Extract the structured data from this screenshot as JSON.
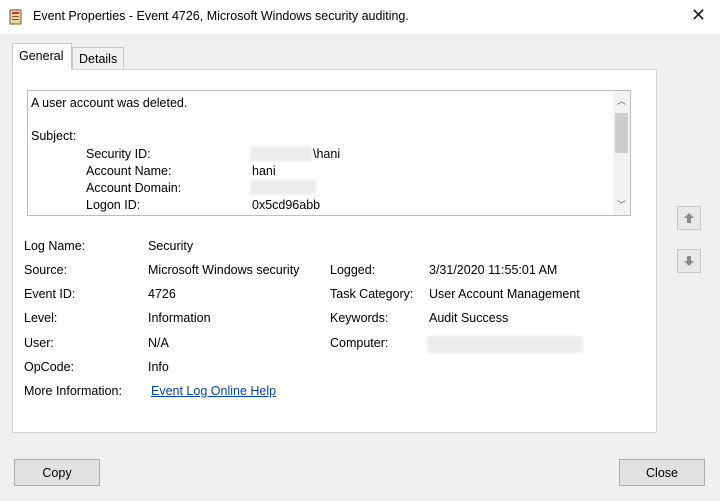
{
  "window": {
    "title": "Event Properties - Event 4726, Microsoft Windows security auditing.",
    "icon": "event-viewer-icon"
  },
  "tabs": [
    {
      "label": "General",
      "active": true
    },
    {
      "label": "Details",
      "active": false
    }
  ],
  "description": {
    "line1": "A user account was deleted.",
    "subject_label": "Subject:",
    "rows": [
      {
        "label": "Security ID:",
        "value": "\\hani"
      },
      {
        "label": "Account Name:",
        "value": "hani"
      },
      {
        "label": "Account Domain:",
        "value": ""
      },
      {
        "label": "Logon ID:",
        "value": "0x5cd96abb"
      }
    ]
  },
  "fields": {
    "log_name": {
      "label": "Log Name:",
      "value": "Security"
    },
    "source": {
      "label": "Source:",
      "value": "Microsoft Windows security"
    },
    "logged": {
      "label": "Logged:",
      "value": "3/31/2020 11:55:01 AM"
    },
    "event_id": {
      "label": "Event ID:",
      "value": "4726"
    },
    "task_category": {
      "label": "Task Category:",
      "value": "User Account Management"
    },
    "level": {
      "label": "Level:",
      "value": "Information"
    },
    "keywords": {
      "label": "Keywords:",
      "value": "Audit Success"
    },
    "user": {
      "label": "User:",
      "value": "N/A"
    },
    "computer": {
      "label": "Computer:",
      "value": ""
    },
    "opcode": {
      "label": "OpCode:",
      "value": "Info"
    },
    "more_info": {
      "label": "More Information:",
      "link": "Event Log Online Help"
    }
  },
  "buttons": {
    "copy": "Copy",
    "close": "Close"
  },
  "colors": {
    "link": "#0645ad",
    "window_bg": "#f0f0f0",
    "panel_bg": "#ffffff"
  }
}
